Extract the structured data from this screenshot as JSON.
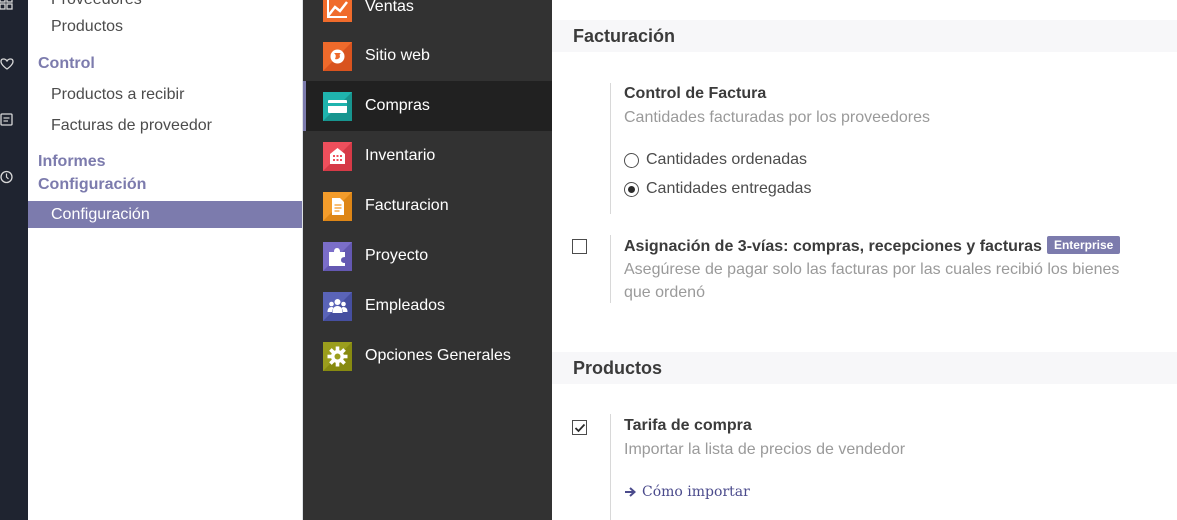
{
  "sidebar": {
    "partial_item": "Proveedores",
    "items_top": [
      {
        "label": "Productos"
      }
    ],
    "control_header": "Control",
    "control_items": [
      {
        "label": "Productos a recibir"
      },
      {
        "label": "Facturas de proveedor"
      }
    ],
    "informes_header": "Informes",
    "configuracion_header": "Configuración",
    "configuracion_item": "Configuración"
  },
  "apps": [
    {
      "label": "Ventas",
      "icon": "ventas-chart-icon",
      "color": "#f06b2b"
    },
    {
      "label": "Sitio web",
      "icon": "globe-icon",
      "color": "#ee6a2b"
    },
    {
      "label": "Compras",
      "icon": "credit-card-icon",
      "color": "#1fb4ae"
    },
    {
      "label": "Inventario",
      "icon": "building-icon",
      "color": "#ee4f5c"
    },
    {
      "label": "Facturacion",
      "icon": "invoice-icon",
      "color": "#f39c2b"
    },
    {
      "label": "Proyecto",
      "icon": "puzzle-icon",
      "color": "#7b6ec9"
    },
    {
      "label": "Empleados",
      "icon": "users-icon",
      "color": "#5a64b8"
    },
    {
      "label": "Opciones Generales",
      "icon": "gear-icon",
      "color": "#9b9e1d"
    }
  ],
  "facturacion": {
    "section_title": "Facturación",
    "control_title": "Control de Factura",
    "control_desc": "Cantidades facturadas por los proveedores",
    "options": [
      {
        "label": "Cantidades ordenadas",
        "checked": false
      },
      {
        "label": "Cantidades entregadas",
        "checked": true
      }
    ],
    "three_way_title": "Asignación de 3-vías: compras, recepciones y facturas",
    "enterprise_badge": "Enterprise",
    "three_way_desc": "Asegúrese de pagar solo las facturas por las cuales recibió los bienes que ordenó",
    "three_way_checked": false
  },
  "productos": {
    "section_title": "Productos",
    "tarifa_title": "Tarifa de compra",
    "tarifa_desc": "Importar la lista de precios de vendedor",
    "tarifa_checked": true,
    "link": "Cómo importar"
  },
  "colors": {
    "accent": "#7c7bad",
    "rail": "#1f2430",
    "panel": "#323232"
  }
}
